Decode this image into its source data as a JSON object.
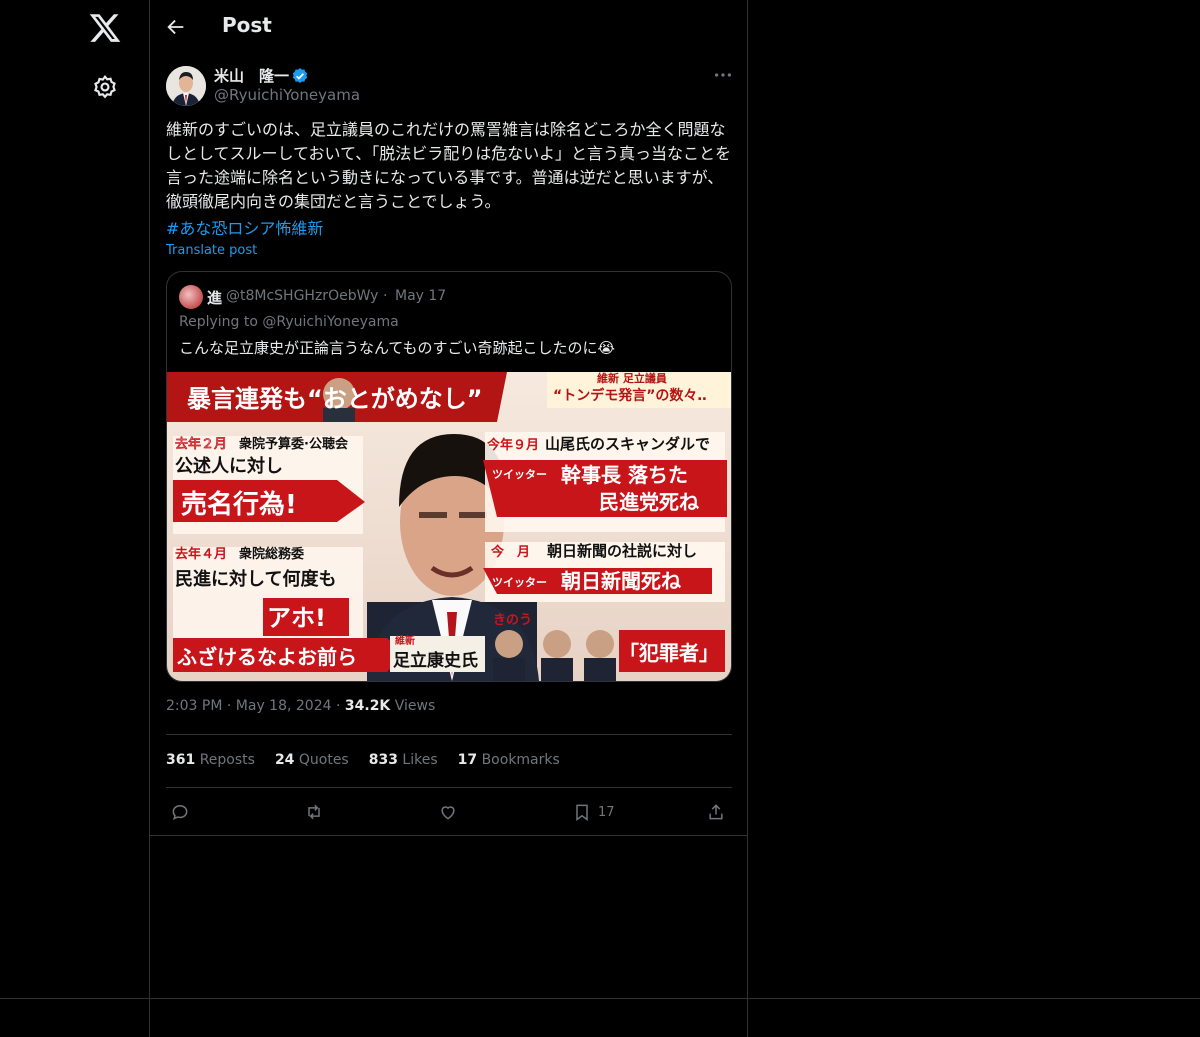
{
  "header": {
    "title": "Post"
  },
  "author": {
    "name": "米山　隆一",
    "handle": "@RyuichiYoneyama"
  },
  "post": {
    "text": "維新のすごいのは、足立議員のこれだけの罵詈雑言は除名どころか全く問題なしとしてスルーしておいて、「脱法ビラ配りは危ないよ」と言う真っ当なことを言った途端に除名という動きになっている事です。普通は逆だと思いますが、徹頭徹尾内向きの集団だと言うことでしょう。",
    "hashtag": "#あな恐ロシア怖維新",
    "translate_label": "Translate post"
  },
  "quote": {
    "name": "進",
    "handle": "@t8McSHGHzrOebWy",
    "separator": "·",
    "date": "May 17",
    "replying_to": "Replying to @RyuichiYoneyama",
    "text": "こんな足立康史が正論言うなんてものすごい奇跡起こしたのに😭",
    "image": {
      "banner_left": "暴言連発も“おとがめなし”",
      "banner_right_top": "維新 足立議員",
      "banner_right": "“トンデモ発言”の数々‥",
      "l1_date": "去年２月",
      "l1_place": "衆院予算委·公聴会",
      "l1_sub": "公述人に対し",
      "l1_quote": "売名行為!",
      "l2_date": "去年４月",
      "l2_place": "衆院総務委",
      "l2_sub": "民進に対して何度も",
      "l2_quote": "アホ!",
      "l3_quote": "ふざけるなよお前ら",
      "r1_date": "今年９月",
      "r1_title": "山尾氏のスキャンダルで",
      "r1_tag": "ツイッター",
      "r1_quote_a": "幹事長 落ちた",
      "r1_quote_b": "民進党死ね",
      "r2_date": "今　月",
      "r2_title": "朝日新聞の社説に対し",
      "r2_tag": "ツイッター",
      "r2_quote": "朝日新聞死ね",
      "r3_date": "きのう",
      "r3_quote": "「犯罪者」",
      "name_party": "維新",
      "name_plate": "足立康史氏"
    }
  },
  "meta": {
    "time": "2:03 PM",
    "dot": "·",
    "date": "May 18, 2024",
    "views_count": "34.2K",
    "views_label": "Views"
  },
  "stats": {
    "reposts_count": "361",
    "reposts_label": "Reposts",
    "quotes_count": "24",
    "quotes_label": "Quotes",
    "likes_count": "833",
    "likes_label": "Likes",
    "bookmarks_count": "17",
    "bookmarks_label": "Bookmarks"
  },
  "actions": {
    "bookmark_count": "17"
  },
  "colors": {
    "accent": "#1d9bf0",
    "muted": "#71767b",
    "text": "#e7e9ea",
    "border": "#2f3336"
  },
  "icons": [
    "x-logo-icon",
    "gear-icon",
    "back-arrow-icon",
    "verified-icon",
    "more-icon",
    "reply-icon",
    "repost-icon",
    "like-icon",
    "bookmark-icon",
    "share-icon"
  ]
}
